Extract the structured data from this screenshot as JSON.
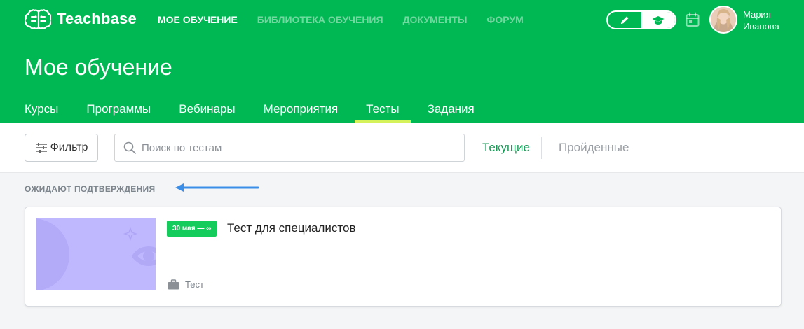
{
  "brand": {
    "name": "Teachbase"
  },
  "topnav": [
    {
      "label": "МОЕ ОБУЧЕНИЕ",
      "active": true
    },
    {
      "label": "БИБЛИОТЕКА ОБУЧЕНИЯ",
      "active": false
    },
    {
      "label": "ДОКУМЕНТЫ",
      "active": false
    },
    {
      "label": "ФОРУМ",
      "active": false
    }
  ],
  "user": {
    "first_name": "Мария",
    "last_name": "Иванова"
  },
  "page": {
    "title": "Мое обучение"
  },
  "tabs": [
    {
      "label": "Курсы",
      "active": false
    },
    {
      "label": "Программы",
      "active": false
    },
    {
      "label": "Вебинары",
      "active": false
    },
    {
      "label": "Мероприятия",
      "active": false
    },
    {
      "label": "Тесты",
      "active": true
    },
    {
      "label": "Задания",
      "active": false
    }
  ],
  "toolbar": {
    "filter_label": "Фильтр",
    "search_placeholder": "Поиск по тестам",
    "search_value": "",
    "status_current": "Текущие",
    "status_completed": "Пройденные"
  },
  "section": {
    "label": "ОЖИДАЮТ ПОДТВЕРЖДЕНИЯ"
  },
  "items": [
    {
      "date_range": "30 мая — ∞",
      "title": "Тест для специалистов",
      "type": "Тест"
    }
  ],
  "colors": {
    "header_bg": "#00b853",
    "tab_underline": "#d6f25b",
    "status_active": "#169a56",
    "badge_bg": "#14cc5c",
    "thumbnail_bg": "#c0b8ff",
    "annotation_arrow": "#3b8ee8"
  },
  "icons": [
    "brain-logo-icon",
    "pencil-icon",
    "graduation-cap-icon",
    "calendar-icon",
    "sliders-icon",
    "search-icon",
    "briefcase-icon",
    "eye-icon",
    "sparkle-icon"
  ]
}
